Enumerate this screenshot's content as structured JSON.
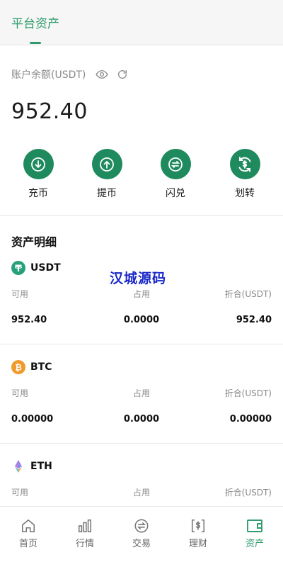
{
  "header": {
    "title": "平台资产"
  },
  "balance": {
    "label": "账户余额(USDT)",
    "value": "952.40"
  },
  "actions": [
    {
      "label": "充币",
      "icon": "deposit-icon"
    },
    {
      "label": "提币",
      "icon": "withdraw-icon"
    },
    {
      "label": "闪兑",
      "icon": "swap-icon"
    },
    {
      "label": "划转",
      "icon": "transfer-icon"
    }
  ],
  "assets_section": {
    "title": "资产明细"
  },
  "watermark": "汉城源码",
  "columns": {
    "available": "可用",
    "occupied": "占用",
    "equivalent": "折合(USDT)"
  },
  "assets": [
    {
      "name": "USDT",
      "available": "952.40",
      "occupied": "0.0000",
      "equivalent": "952.40",
      "color": "#26a17b"
    },
    {
      "name": "BTC",
      "available": "0.00000",
      "occupied": "0.0000",
      "equivalent": "0.00000",
      "color": "#f09a2b"
    },
    {
      "name": "ETH",
      "available": "",
      "occupied": "",
      "equivalent": ""
    }
  ],
  "nav": [
    {
      "label": "首页",
      "icon": "home-icon"
    },
    {
      "label": "行情",
      "icon": "market-chart-icon"
    },
    {
      "label": "交易",
      "icon": "trade-icon"
    },
    {
      "label": "理财",
      "icon": "finance-icon"
    },
    {
      "label": "资产",
      "icon": "wallet-icon",
      "active": true
    }
  ],
  "colors": {
    "accent": "#2f9b6e",
    "action_bg": "#1f8a5e",
    "watermark": "#1a28c8"
  }
}
